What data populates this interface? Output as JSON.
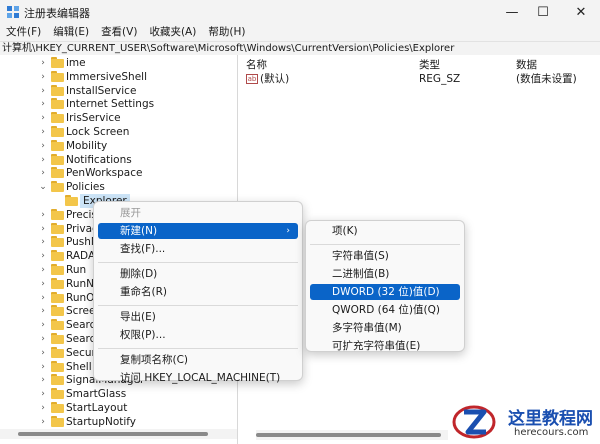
{
  "window": {
    "title": "注册表编辑器",
    "min_glyph": "—",
    "max_glyph": "☐",
    "close_glyph": "✕"
  },
  "menu": [
    "文件(F)",
    "编辑(E)",
    "查看(V)",
    "收藏夹(A)",
    "帮助(H)"
  ],
  "address": "计算机\\HKEY_CURRENT_USER\\Software\\Microsoft\\Windows\\CurrentVersion\\Policies\\Explorer",
  "tree": {
    "items": [
      {
        "label": "ime",
        "expanded": false,
        "level": 0
      },
      {
        "label": "ImmersiveShell",
        "expanded": false,
        "level": 0
      },
      {
        "label": "InstallService",
        "expanded": false,
        "level": 0
      },
      {
        "label": "Internet Settings",
        "expanded": false,
        "level": 0
      },
      {
        "label": "IrisService",
        "expanded": false,
        "level": 0
      },
      {
        "label": "Lock Screen",
        "expanded": false,
        "level": 0
      },
      {
        "label": "Mobility",
        "expanded": false,
        "level": 0
      },
      {
        "label": "Notifications",
        "expanded": false,
        "level": 0
      },
      {
        "label": "PenWorkspace",
        "expanded": false,
        "level": 0
      },
      {
        "label": "Policies",
        "expanded": true,
        "level": 0
      },
      {
        "label": "Explorer",
        "expanded": null,
        "level": 1,
        "selected": true
      },
      {
        "label": "Precis",
        "expanded": false,
        "level": 0
      },
      {
        "label": "Privac",
        "expanded": false,
        "level": 0
      },
      {
        "label": "PushN",
        "expanded": false,
        "level": 0
      },
      {
        "label": "RADA",
        "expanded": false,
        "level": 0
      },
      {
        "label": "Run",
        "expanded": false,
        "level": 0
      },
      {
        "label": "RunN",
        "expanded": false,
        "level": 0
      },
      {
        "label": "RunO",
        "expanded": false,
        "level": 0
      },
      {
        "label": "Scree",
        "expanded": false,
        "level": 0
      },
      {
        "label": "Searc",
        "expanded": false,
        "level": 0
      },
      {
        "label": "Searc",
        "expanded": false,
        "level": 0
      },
      {
        "label": "Secur",
        "expanded": false,
        "level": 0
      },
      {
        "label": "Shell",
        "expanded": false,
        "level": 0
      },
      {
        "label": "SignalManager",
        "expanded": false,
        "level": 0
      },
      {
        "label": "SmartGlass",
        "expanded": false,
        "level": 0
      },
      {
        "label": "StartLayout",
        "expanded": false,
        "level": 0
      },
      {
        "label": "StartupNotify",
        "expanded": false,
        "level": 0
      }
    ]
  },
  "values": {
    "columns": {
      "name": "名称",
      "type": "类型",
      "data": "数据"
    },
    "rows": [
      {
        "icon": "ab",
        "name": "(默认)",
        "type": "REG_SZ",
        "data": "(数值未设置)"
      }
    ]
  },
  "context_menu": {
    "items": [
      {
        "label": "展开",
        "disabled": true
      },
      {
        "label": "新建(N)",
        "highlighted": true,
        "submenu": true
      },
      {
        "label": "查找(F)..."
      },
      {
        "sep": true
      },
      {
        "label": "删除(D)"
      },
      {
        "label": "重命名(R)"
      },
      {
        "sep": true
      },
      {
        "label": "导出(E)"
      },
      {
        "label": "权限(P)..."
      },
      {
        "sep": true
      },
      {
        "label": "复制项名称(C)"
      },
      {
        "label": "访问 HKEY_LOCAL_MACHINE(T)"
      }
    ],
    "arrow_glyph": "›"
  },
  "submenu": {
    "items": [
      {
        "label": "项(K)"
      },
      {
        "sep": true
      },
      {
        "label": "字符串值(S)"
      },
      {
        "label": "二进制值(B)"
      },
      {
        "label": "DWORD (32 位)值(D)",
        "highlighted": true
      },
      {
        "label": "QWORD (64 位)值(Q)"
      },
      {
        "label": "多字符串值(M)"
      },
      {
        "label": "可扩充字符串值(E)"
      }
    ]
  },
  "watermark": {
    "title": "这里教程网",
    "url": "herecours.com"
  },
  "colors": {
    "accent": "#0a64c8",
    "folder": "#f3c64a",
    "selection": "#cce4f7"
  }
}
